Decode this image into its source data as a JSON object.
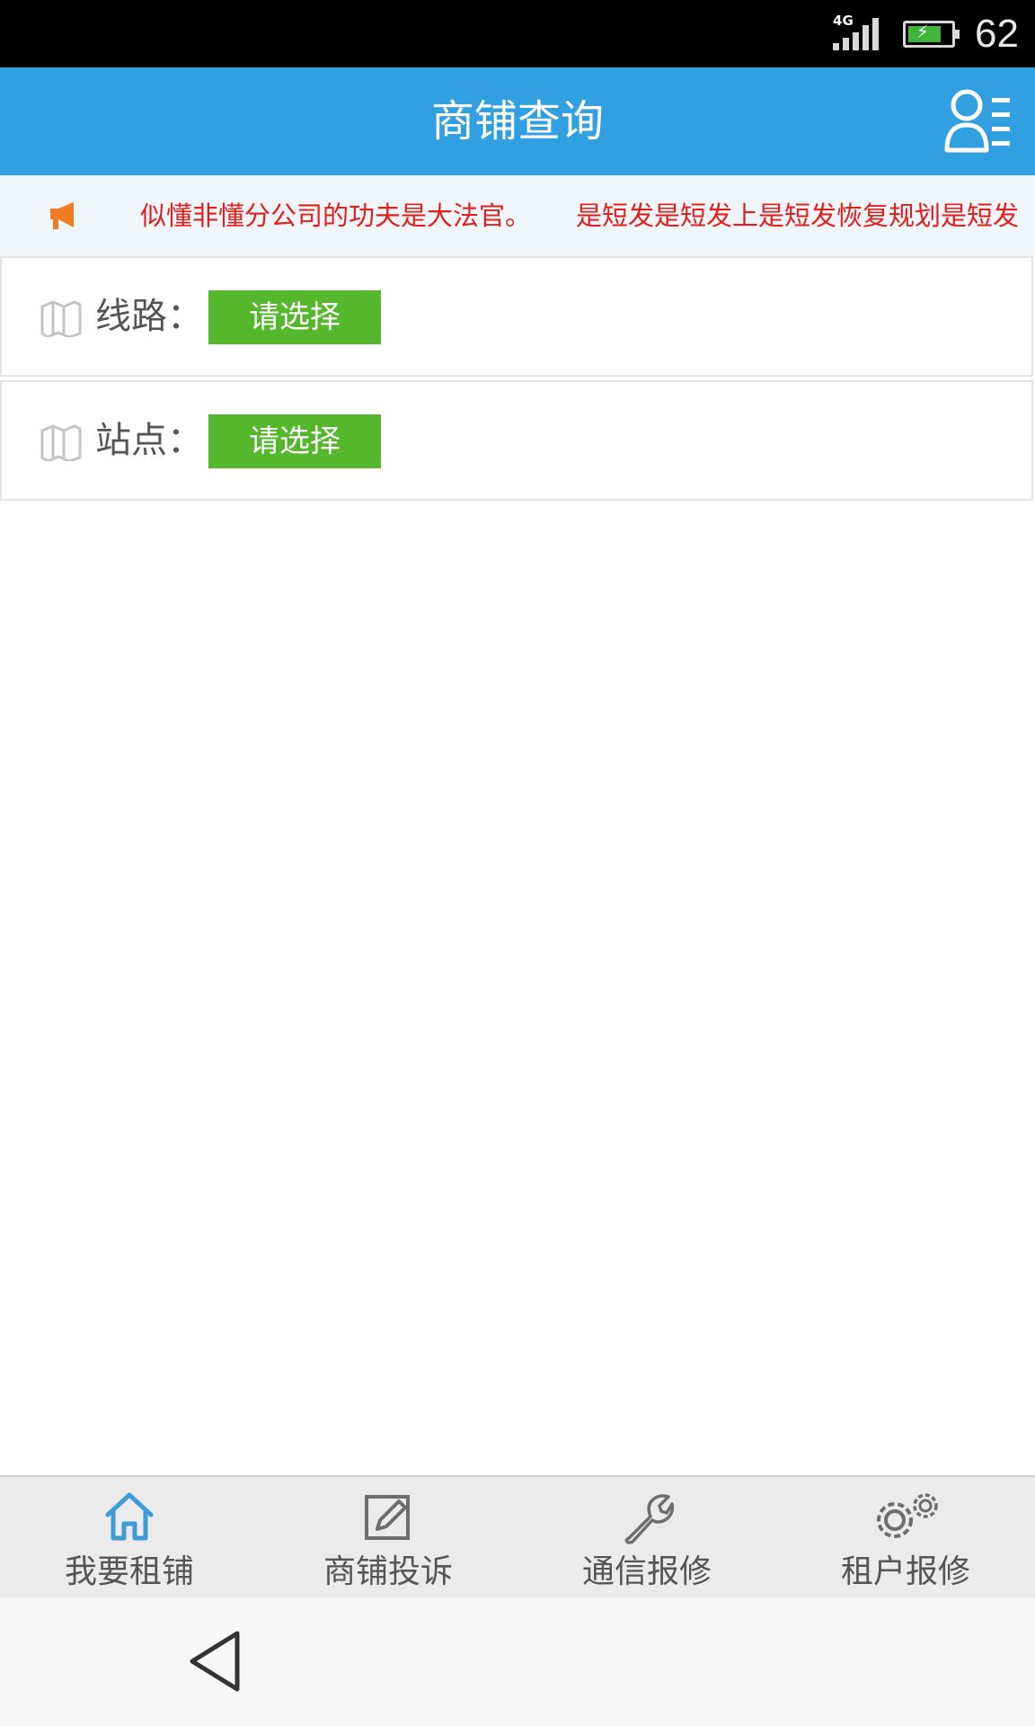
{
  "status_bar": {
    "network": "4G",
    "battery_level": "62",
    "battery_fill_fraction": 0.62,
    "icons": [
      "signal-icon",
      "battery-charging-icon"
    ]
  },
  "header": {
    "title": "商铺查询",
    "user_icon": "user-menu-icon",
    "color": "#31a0e0"
  },
  "notice": {
    "icon": "megaphone-icon",
    "messages": [
      "似懂非懂分公司的功夫是大法官。",
      "是短发是短发上是短发恢复规划是短发"
    ],
    "color": "#e0201c"
  },
  "form": {
    "line": {
      "label": "线路：",
      "button": "请选择",
      "icon": "map-icon"
    },
    "station": {
      "label": "站点：",
      "button": "请选择",
      "icon": "map-icon"
    },
    "button_color": "#55b72c"
  },
  "tabs": [
    {
      "label": "我要租铺",
      "icon": "home-icon",
      "active": true
    },
    {
      "label": "商铺投诉",
      "icon": "edit-icon",
      "active": false
    },
    {
      "label": "通信报修",
      "icon": "wrench-icon",
      "active": false
    },
    {
      "label": "租户报修",
      "icon": "gears-icon",
      "active": false
    }
  ],
  "nav": {
    "back_icon": "back-triangle-icon"
  }
}
